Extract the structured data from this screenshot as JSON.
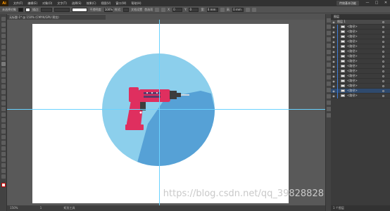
{
  "app": {
    "logo": "Ai"
  },
  "menubar": {
    "items": [
      "文件(F)",
      "编辑(E)",
      "对象(O)",
      "文字(T)",
      "选择(S)",
      "效果(C)",
      "视图(V)",
      "窗口(W)",
      "帮助(H)"
    ],
    "workspace": "传统基本功能",
    "window_controls": [
      "—",
      "□",
      "✕"
    ]
  },
  "control": {
    "selection_label": "未选择对象",
    "stroke_label": "描边:",
    "opacity_label": "不透明度:",
    "opacity_value": "100%",
    "style_label": "样式:",
    "doc_setup": "文档设置",
    "prefs": "首选项",
    "x_label": "X:",
    "x_value": "0",
    "y_label": "Y:",
    "y_value": "0",
    "w_label": "宽:",
    "w_value": "0 mm",
    "h_label": "高:",
    "h_value": "0 mm"
  },
  "document": {
    "tab_title": "无标题-1* @ 150% (CMYK/GPU 预览)"
  },
  "status": {
    "zoom": "150%",
    "tool": "矩形工具",
    "page": "1"
  },
  "watermark": "https://blog.csdn.net/qq_39828828",
  "layers_panel": {
    "tab": "图层",
    "top_layer": "图层 1",
    "items": [
      "<路径>",
      "<路径>",
      "<路径>",
      "<路径>",
      "<路径>",
      "<路径>",
      "<路径>",
      "<路径>",
      "<路径>",
      "<路径>",
      "<路径>",
      "<路径>",
      "<路径>",
      "<路径>",
      "<路径>"
    ],
    "footer": "1 个图层"
  },
  "colors": {
    "circle": "#8ccfec",
    "shadow": "#56a1d6",
    "drill_body": "#df2f5f",
    "drill_dark": "#3d3d3d",
    "guide": "#6ad3ff"
  }
}
